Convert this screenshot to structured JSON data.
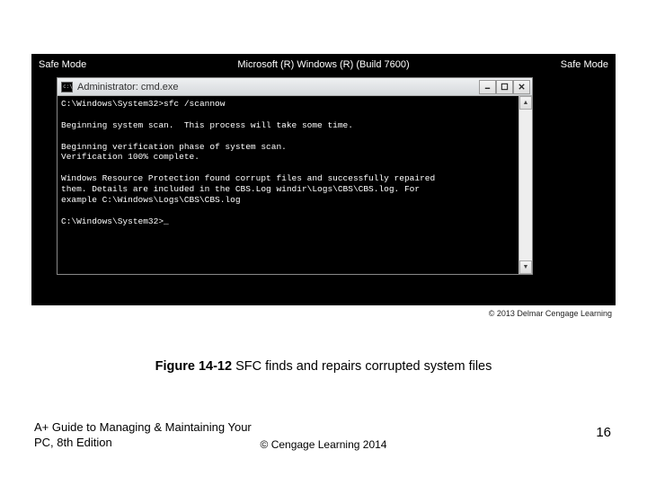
{
  "safemode": {
    "left": "Safe Mode",
    "center": "Microsoft (R) Windows (R) (Build 7600)",
    "right": "Safe Mode"
  },
  "window": {
    "title": "Administrator: cmd.exe"
  },
  "console": {
    "prompt1": "C:\\Windows\\System32>",
    "command": "sfc /scannow",
    "line1": "Beginning system scan.  This process will take some time.",
    "line2": "Beginning verification phase of system scan.",
    "line3": "Verification 100% complete.",
    "line4": "Windows Resource Protection found corrupt files and successfully repaired",
    "line5": "them. Details are included in the CBS.Log windir\\Logs\\CBS\\CBS.log. For",
    "line6": "example C:\\Windows\\Logs\\CBS\\CBS.log",
    "prompt2": "C:\\Windows\\System32>",
    "cursor": "_"
  },
  "credit": "© 2013 Delmar Cengage Learning",
  "caption": {
    "label": "Figure 14-12",
    "text": "  SFC finds and repairs corrupted system files"
  },
  "footer": {
    "book": "A+ Guide to Managing & Maintaining Your PC, 8th Edition",
    "copyright": "© Cengage Learning  2014",
    "page": "16"
  }
}
